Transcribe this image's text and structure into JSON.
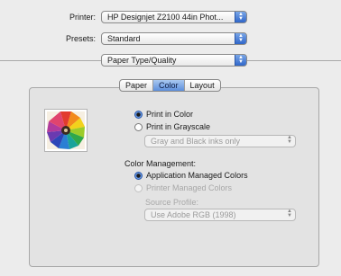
{
  "printer": {
    "label": "Printer:",
    "value": "HP Designjet Z2100 44in Phot..."
  },
  "presets": {
    "label": "Presets:",
    "value": "Standard"
  },
  "panel_select": {
    "value": "Paper Type/Quality"
  },
  "tabs": [
    {
      "label": "Paper",
      "active": false
    },
    {
      "label": "Color",
      "active": true
    },
    {
      "label": "Layout",
      "active": false
    }
  ],
  "color_mode": {
    "print_in_color": "Print in Color",
    "print_in_grayscale": "Print in Grayscale",
    "grayscale_select": "Gray and Black inks only"
  },
  "color_management": {
    "heading": "Color Management:",
    "application_managed": "Application Managed Colors",
    "printer_managed": "Printer Managed Colors",
    "source_profile_label": "Source Profile:",
    "source_profile_value": "Use Adobe RGB (1998)"
  },
  "icons": {
    "popup_arrows": "updown-arrows-icon",
    "thumbnail": "color-pencils-image"
  },
  "colors": {
    "accent": "#3a6fd0",
    "window_bg": "#ececec",
    "panel_bg": "#e3e3e3"
  }
}
